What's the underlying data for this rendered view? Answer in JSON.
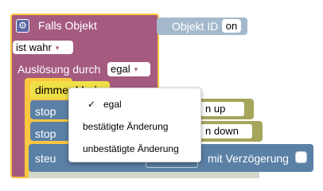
{
  "hat_block": {
    "title": "Falls Objekt",
    "gear_icon": "gear-icon"
  },
  "objekt_id": {
    "label": "Objekt ID",
    "value": "on"
  },
  "condition": {
    "value": "ist wahr",
    "arrow": "▾"
  },
  "trigger": {
    "label": "Auslösung durch",
    "value": "egal",
    "arrow": "▾"
  },
  "statements": {
    "dimmer_label": "dimmer Merker",
    "stop_label": "stop",
    "up_value": "n up",
    "down_value": "n down",
    "steuer_label": "steu",
    "delay_label": "mit Verzögerung"
  },
  "dropdown_menu": {
    "check": "✓",
    "items": [
      {
        "label": "egal",
        "selected": true
      },
      {
        "label": "bestätigte Änderung",
        "selected": false
      },
      {
        "label": "unbestätigte Änderung",
        "selected": false
      }
    ]
  },
  "colors": {
    "event_block": "#a55b80",
    "selection_outline": "#fcc640",
    "object_block": "#a5b9cd",
    "control_block": "#5b80a5",
    "value_block": "#a5a55b"
  }
}
